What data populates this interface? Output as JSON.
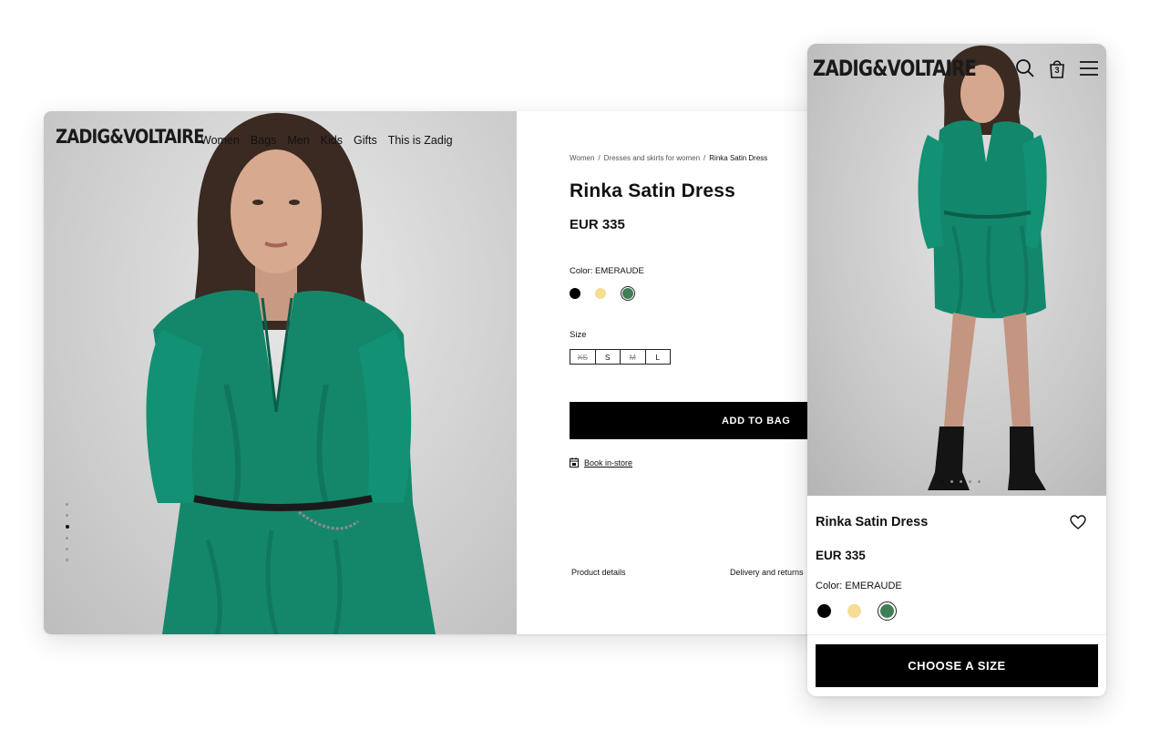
{
  "desktop": {
    "logo": "ZADIG&VOLTAIRE",
    "nav": [
      "Women",
      "Bags",
      "Men",
      "Kids",
      "Gifts",
      "This is Zadig"
    ],
    "breadcrumb": [
      "Women",
      "Dresses and skirts for women",
      "Rinka Satin Dress"
    ],
    "product_title": "Rinka Satin Dress",
    "price": "EUR 335",
    "color_label": "Color: EMERAUDE",
    "swatches": [
      {
        "name": "black",
        "color": "#000000",
        "selected": false
      },
      {
        "name": "yellow",
        "color": "#f5dd93",
        "selected": false
      },
      {
        "name": "emeraude",
        "color": "#3e7f55",
        "selected": true
      }
    ],
    "size_label": "Size",
    "sizes": [
      {
        "label": "XS",
        "available": false
      },
      {
        "label": "S",
        "available": true
      },
      {
        "label": "M",
        "available": false
      },
      {
        "label": "L",
        "available": true
      }
    ],
    "add_to_bag": "ADD TO BAG",
    "book_instore": "Book in-store",
    "tabs": [
      "Product details",
      "Delivery and returns"
    ],
    "carousel": {
      "count": 6,
      "active_index": 2
    }
  },
  "mobile": {
    "logo": "ZADIG&VOLTAIRE",
    "bag_count": "3",
    "product_title": "Rinka Satin Dress",
    "price": "EUR 335",
    "color_label": "Color: EMERAUDE",
    "choose_size": "CHOOSE A SIZE",
    "carousel": {
      "count": 5,
      "active_index": 0
    }
  },
  "colors": {
    "dress_green": "#14876a",
    "button_black": "#000000"
  }
}
